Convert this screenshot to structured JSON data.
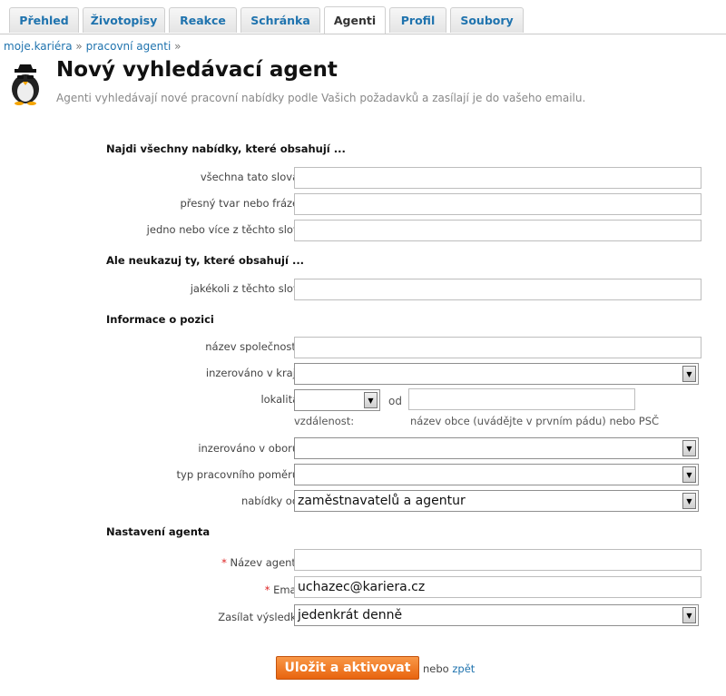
{
  "tabs": [
    {
      "label": "Přehled"
    },
    {
      "label": "Životopisy"
    },
    {
      "label": "Reakce"
    },
    {
      "label": "Schránka"
    },
    {
      "label": "Agenti"
    },
    {
      "label": "Profil"
    },
    {
      "label": "Soubory"
    }
  ],
  "breadcrumb": {
    "home": "moje.kariéra",
    "sep": "»",
    "current": "pracovní agenti"
  },
  "page": {
    "title": "Nový vyhledávací agent",
    "subtitle": "Agenti vyhledávají nové pracovní nabídky podle Vašich požadavků a zasílají je do vašeho emailu."
  },
  "sections": {
    "include": "Najdi všechny nabídky, které obsahují ...",
    "exclude": "Ale neukazuj ty, které obsahují ...",
    "position": "Informace o pozici",
    "settings": "Nastavení agenta"
  },
  "fields": {
    "all_words": {
      "label": "všechna tato slova:",
      "value": ""
    },
    "exact_phrase": {
      "label": "přesný tvar nebo fráze:",
      "value": ""
    },
    "any_words": {
      "label": "jedno nebo více z těchto slov:",
      "value": ""
    },
    "none_words": {
      "label": "jakékoli z těchto slov:",
      "value": ""
    },
    "company": {
      "label": "název společnosti:",
      "value": ""
    },
    "region": {
      "label": "inzerováno v kraji:",
      "value": ""
    },
    "locality": {
      "label": "lokalita:",
      "distance_value": "",
      "distance_caption": "vzdálenost:",
      "od": "od",
      "town_value": "",
      "town_caption": "název obce (uvádějte v prvním pádu) nebo PSČ"
    },
    "field": {
      "label": "inzerováno v oboru:",
      "value": ""
    },
    "employment": {
      "label": "typ pracovního poměru:",
      "value": ""
    },
    "offers_from": {
      "label": "nabídky od:",
      "value": "zaměstnavatelů a agentur"
    },
    "agent_name": {
      "required_mark": "*",
      "label": "Název agenta",
      "value": ""
    },
    "email": {
      "required_mark": "*",
      "label": "Email",
      "value": "uchazec@kariera.cz"
    },
    "frequency": {
      "label": "Zasílat výsledky",
      "value": "jedenkrát denně"
    }
  },
  "actions": {
    "save": "Uložit a aktivovat",
    "or": "nebo",
    "back": "zpět"
  },
  "colors": {
    "link": "#1f73ae",
    "button": "#f0771f",
    "required": "#dd2222"
  }
}
